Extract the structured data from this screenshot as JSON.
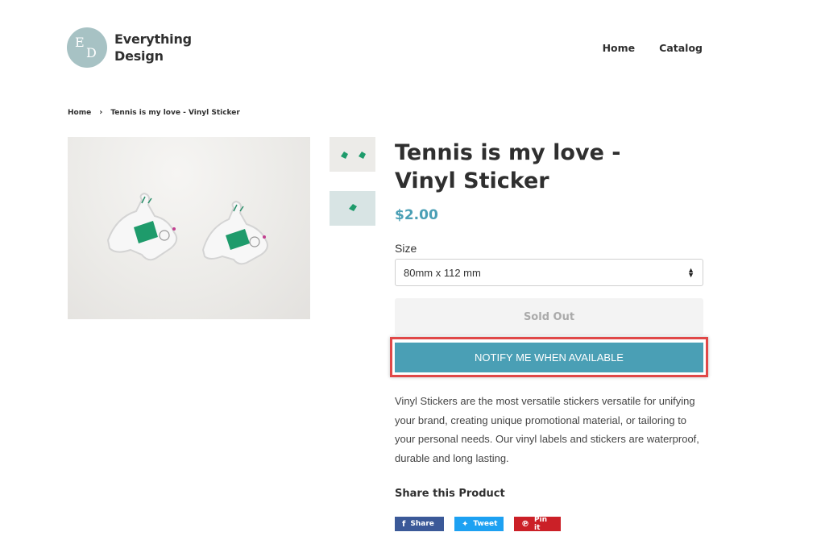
{
  "brand": {
    "name_line1": "Everything",
    "name_line2": "Design",
    "logo_letter_1": "E",
    "logo_letter_2": "D",
    "badge_color": "#a7c2c4"
  },
  "nav": {
    "home": "Home",
    "catalog": "Catalog"
  },
  "breadcrumb": {
    "home": "Home",
    "separator": "›",
    "current": "Tennis is my love - Vinyl Sticker"
  },
  "product": {
    "title": "Tennis is my love - Vinyl Sticker",
    "price": "$2.00",
    "size_label": "Size",
    "size_value": "80mm x 112 mm",
    "sold_out_label": "Sold Out",
    "notify_label": "NOTIFY ME WHEN AVAILABLE",
    "description": "Vinyl Stickers are the most versatile stickers versatile for unifying your brand, creating unique promotional material, or tailoring to your personal needs. Our vinyl labels and stickers are waterproof, durable and long lasting."
  },
  "share": {
    "title": "Share this Product",
    "facebook": {
      "icon": "facebook-icon",
      "label": "Share"
    },
    "twitter": {
      "icon": "twitter-icon",
      "label": "Tweet"
    },
    "pinterest": {
      "icon": "pinterest-icon",
      "label": "Pin it"
    }
  },
  "colors": {
    "accent": "#4a9fb5",
    "highlight_border": "#e04848",
    "facebook": "#3b5998",
    "twitter": "#1da1f2",
    "pinterest": "#cb2027"
  }
}
